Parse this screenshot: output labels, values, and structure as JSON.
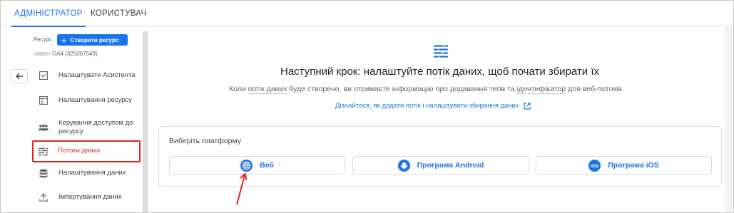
{
  "tabs": [
    {
      "label": "АДМІНІСТРАТОР",
      "active": true
    },
    {
      "label": "КОРИСТУВАЧ",
      "active": false
    }
  ],
  "sidebar": {
    "resource_label": "Ресурс",
    "create_button": "Створити ресурс",
    "property_name": "GA4 (325067549)",
    "items": [
      {
        "label": "Налаштувати Асистента",
        "icon": "checkbox-icon"
      },
      {
        "label": "Налаштування ресурсу",
        "icon": "layout-icon"
      },
      {
        "label": "Керування доступом до ресурсу",
        "icon": "people-icon"
      },
      {
        "label": "Потоки даних",
        "icon": "streams-icon",
        "active": true
      },
      {
        "label": "Налаштування даних",
        "icon": "database-icon"
      },
      {
        "label": "Імпортування даних",
        "icon": "upload-icon"
      }
    ]
  },
  "main": {
    "headline": "Наступний крок: налаштуйте потік даних, щоб почати збирати їх",
    "subline": {
      "part1": "Коли ",
      "term1": "потік даних",
      "part2": " буде створено, ви отримаєте інформацію про додавання тегів та ",
      "term2": "ідентифікатор",
      "part3": " для веб-потоків."
    },
    "learn_link": "Дізнайтеся, як додати потік і налаштувати збирання даних",
    "platform_title": "Виберіть платформу",
    "platforms": [
      {
        "label": "Веб",
        "icon": "globe-icon"
      },
      {
        "label": "Програма Android",
        "icon": "android-icon"
      },
      {
        "label": "Програма iOS",
        "icon": "ios-icon"
      }
    ]
  },
  "colors": {
    "accent": "#1a73e8",
    "highlight": "#e0241d",
    "active_text": "#d93025"
  }
}
